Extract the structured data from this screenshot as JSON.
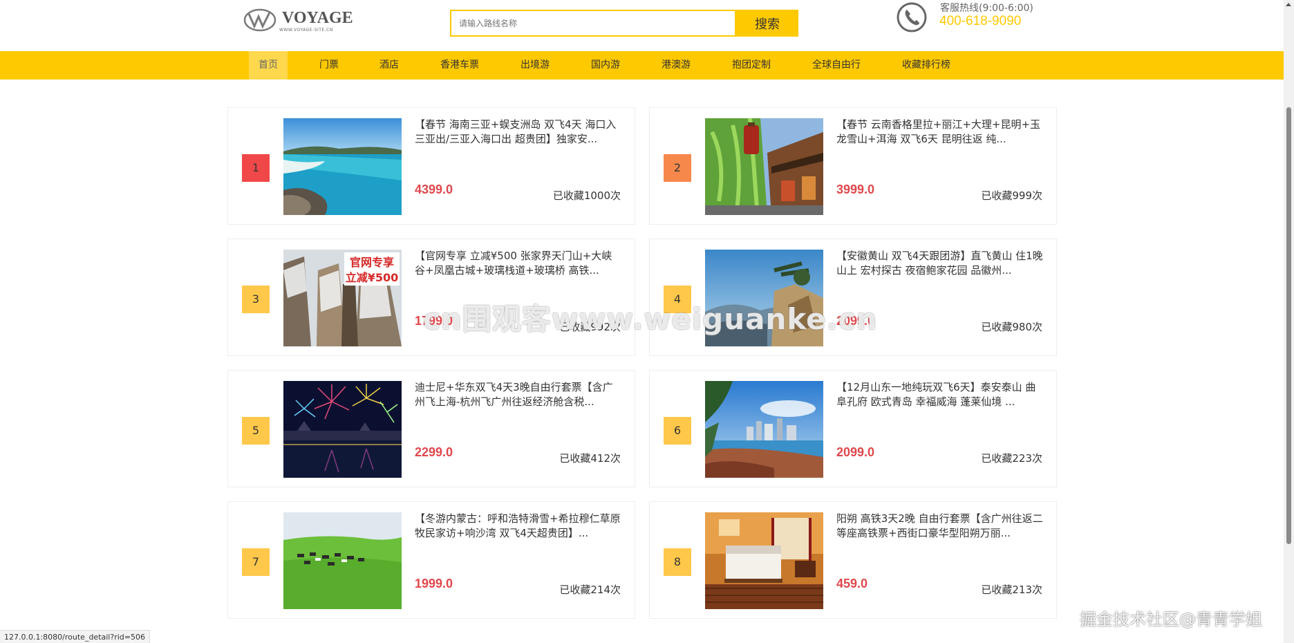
{
  "header": {
    "logo_text": "VOYAGE",
    "logo_sub": "WWW.VOYAGE-SITE.CN",
    "search_placeholder": "请输入路线名称",
    "search_button": "搜索",
    "hotline_label": "客服热线(9:00-6:00)",
    "hotline_number": "400-618-9090"
  },
  "nav": {
    "items": [
      {
        "label": "首页",
        "active": true
      },
      {
        "label": "门票"
      },
      {
        "label": "酒店"
      },
      {
        "label": "香港车票"
      },
      {
        "label": "出境游"
      },
      {
        "label": "国内游"
      },
      {
        "label": "港澳游"
      },
      {
        "label": "抱团定制"
      },
      {
        "label": "全球自由行"
      },
      {
        "label": "收藏排行榜"
      }
    ]
  },
  "colors": {
    "brand": "#ffc900",
    "price": "#e0474c",
    "rank_top1": "#f04848",
    "rank_top2": "#f5884a",
    "rank_other": "#ffc84a"
  },
  "routes": [
    {
      "rank": "1",
      "title": "【春节 海南三亚+蜈支洲岛 双飞4天 海口入三亚出/三亚入海口出 超贵团】独家安...",
      "price": "4399.0",
      "fav": "已收藏1000次",
      "image": "tropical-beach"
    },
    {
      "rank": "2",
      "title": "【春节 云南香格里拉+丽江+大理+昆明+玉龙雪山+洱海 双飞6天 昆明往返 纯...",
      "price": "3999.0",
      "fav": "已收藏999次",
      "image": "old-town-lantern"
    },
    {
      "rank": "3",
      "title": "【官网专享 立减¥500 张家界天门山+大峡谷+凤凰古城+玻璃栈道+玻璃桥 高铁...",
      "price": "1799.0",
      "fav": "已收藏992次",
      "image": "snowy-mountains",
      "badge_line1": "官网专享",
      "badge_line2": "立减¥500"
    },
    {
      "rank": "4",
      "title": "【安徽黄山 双飞4天跟团游】直飞黄山 住1晚山上 宏村探古 夜宿鲍家花园 品徽州...",
      "price": "2099.0",
      "fav": "已收藏980次",
      "image": "mountain-pines"
    },
    {
      "rank": "5",
      "title": "迪士尼+华东双飞4天3晚自由行套票【含广州飞上海-杭州飞广州往返经济舱含税...",
      "price": "2299.0",
      "fav": "已收藏412次",
      "image": "fireworks"
    },
    {
      "rank": "6",
      "title": "【12月山东一地纯玩双飞6天】泰安泰山 曲阜孔府 欧式青岛 幸福威海 蓬莱仙境 ...",
      "price": "2099.0",
      "fav": "已收藏223次",
      "image": "coastal-city"
    },
    {
      "rank": "7",
      "title": "【冬游内蒙古：呼和浩特滑雪+希拉穆仁草原牧民家访+响沙湾 双飞4天超贵团】...",
      "price": "1999.0",
      "fav": "已收藏214次",
      "image": "grassland-cattle"
    },
    {
      "rank": "8",
      "title": "阳朔 高铁3天2晚 自由行套票【含广州往返二等座高铁票+西街口豪华型阳朔万丽...",
      "price": "459.0",
      "fav": "已收藏213次",
      "image": "hotel-room"
    }
  ],
  "status_url": "127.0.0.1:8080/route_detail?rid=506",
  "watermark": "cn围观客www.weiguanke.cn",
  "corner_mark": "掘金技术社区@青青学姐"
}
